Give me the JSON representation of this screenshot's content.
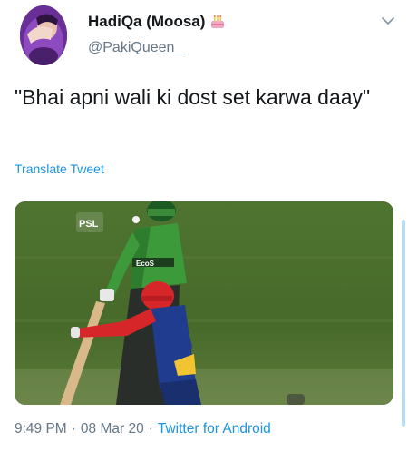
{
  "tweet": {
    "author": {
      "display_name": "HadiQa (Moosa)",
      "handle": "@PakiQueen_",
      "name_emoji_icon": "birthday-cake-icon"
    },
    "text": "\"Bhai apni wali ki dost set karwa daay\"",
    "translate_label": "Translate Tweet",
    "media": {
      "watermark": "PSL",
      "jersey_text_green": "EcoS",
      "bat_text": "",
      "description_icon": "cricket-photo"
    },
    "meta": {
      "time": "9:49 PM",
      "date": "08 Mar 20",
      "separator": "·",
      "source": "Twitter for Android"
    }
  },
  "colors": {
    "link_blue": "#1b95e0",
    "secondary_text": "#657786",
    "primary_text": "#14171a"
  }
}
